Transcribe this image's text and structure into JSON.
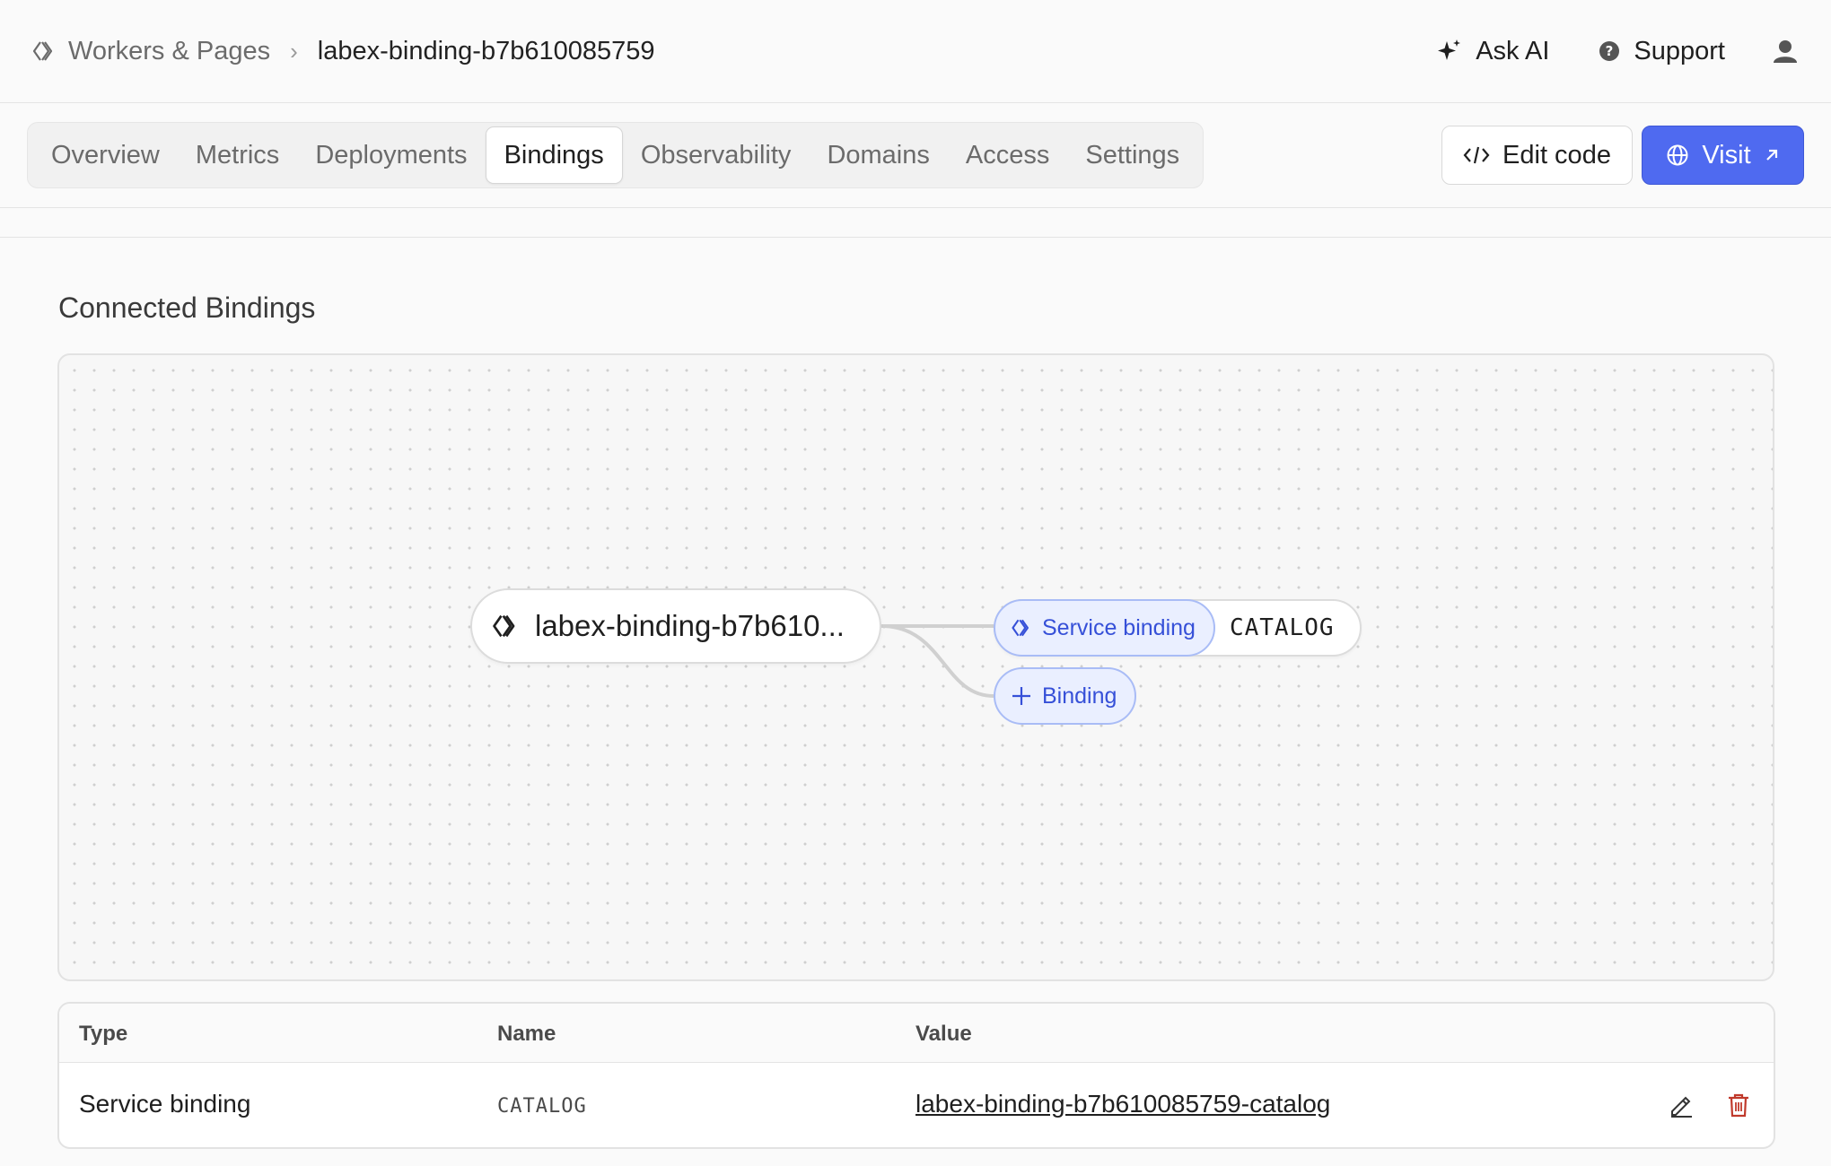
{
  "breadcrumb": {
    "root": "Workers & Pages",
    "current": "labex-binding-b7b610085759"
  },
  "header": {
    "ask_ai": "Ask AI",
    "support": "Support"
  },
  "tabs": [
    {
      "label": "Overview",
      "active": false
    },
    {
      "label": "Metrics",
      "active": false
    },
    {
      "label": "Deployments",
      "active": false
    },
    {
      "label": "Bindings",
      "active": true
    },
    {
      "label": "Observability",
      "active": false
    },
    {
      "label": "Domains",
      "active": false
    },
    {
      "label": "Access",
      "active": false
    },
    {
      "label": "Settings",
      "active": false
    }
  ],
  "actions": {
    "edit_code": "Edit code",
    "visit": "Visit"
  },
  "section": {
    "title": "Connected Bindings"
  },
  "graph": {
    "worker_label": "labex-binding-b7b610...",
    "binding_type": "Service binding",
    "binding_name": "CATALOG",
    "add_label": "Binding"
  },
  "table": {
    "headers": {
      "type": "Type",
      "name": "Name",
      "value": "Value"
    },
    "rows": [
      {
        "type": "Service binding",
        "name": "CATALOG",
        "value": "labex-binding-b7b610085759-catalog"
      }
    ]
  },
  "colors": {
    "accent": "#4f6af0",
    "binding_fill": "#eaefff",
    "binding_border": "#a9bcf6",
    "binding_text": "#3650d8",
    "delete": "#c0392b"
  }
}
